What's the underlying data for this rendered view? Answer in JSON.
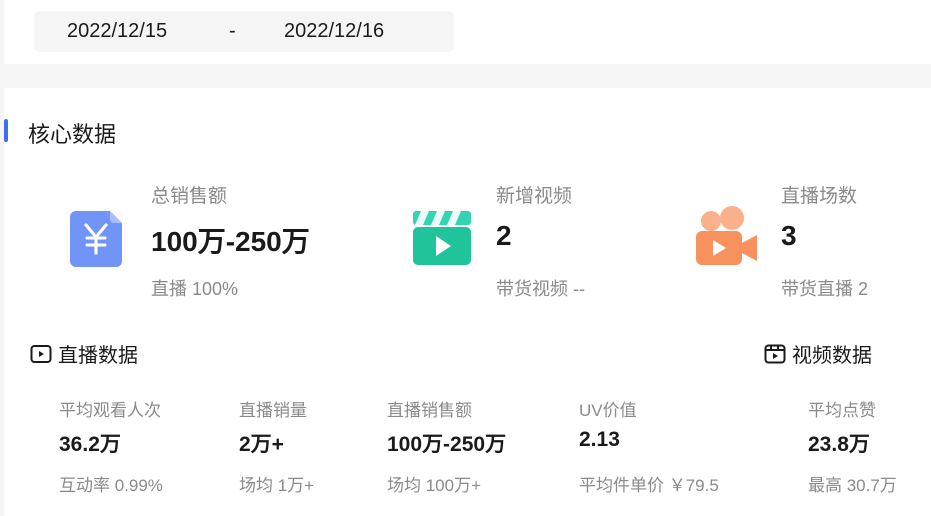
{
  "date_range": {
    "start": "2022/12/15",
    "separator": "-",
    "end": "2022/12/16"
  },
  "core": {
    "title": "核心数据",
    "metrics": [
      {
        "icon": "yuan-document-icon",
        "label": "总销售额",
        "value": "100万-250万",
        "sub": "直播 100%",
        "color": "#6f8ff7"
      },
      {
        "icon": "video-clapper-icon",
        "label": "新增视频",
        "value": "2",
        "sub": "带货视频 --",
        "color": "#2bc9a4"
      },
      {
        "icon": "video-camera-icon",
        "label": "直播场数",
        "value": "3",
        "sub": "带货直播 2",
        "color": "#f79a6c"
      }
    ]
  },
  "live_section": {
    "label": "直播数据",
    "icon": "live-monitor-icon"
  },
  "video_section": {
    "label": "视频数据",
    "icon": "video-list-icon"
  },
  "stats": [
    {
      "label": "平均观看人次",
      "value": "36.2万",
      "sub": "互动率 0.99%"
    },
    {
      "label": "直播销量",
      "value": "2万+",
      "sub": "场均 1万+"
    },
    {
      "label": "直播销售额",
      "value": "100万-250万",
      "sub": "场均 100万+"
    },
    {
      "label": "UV价值",
      "value": "2.13",
      "sub": "平均件单价 ￥79.5"
    },
    {
      "label": "平均点赞",
      "value": "23.8万",
      "sub": "最高 30.7万"
    }
  ]
}
